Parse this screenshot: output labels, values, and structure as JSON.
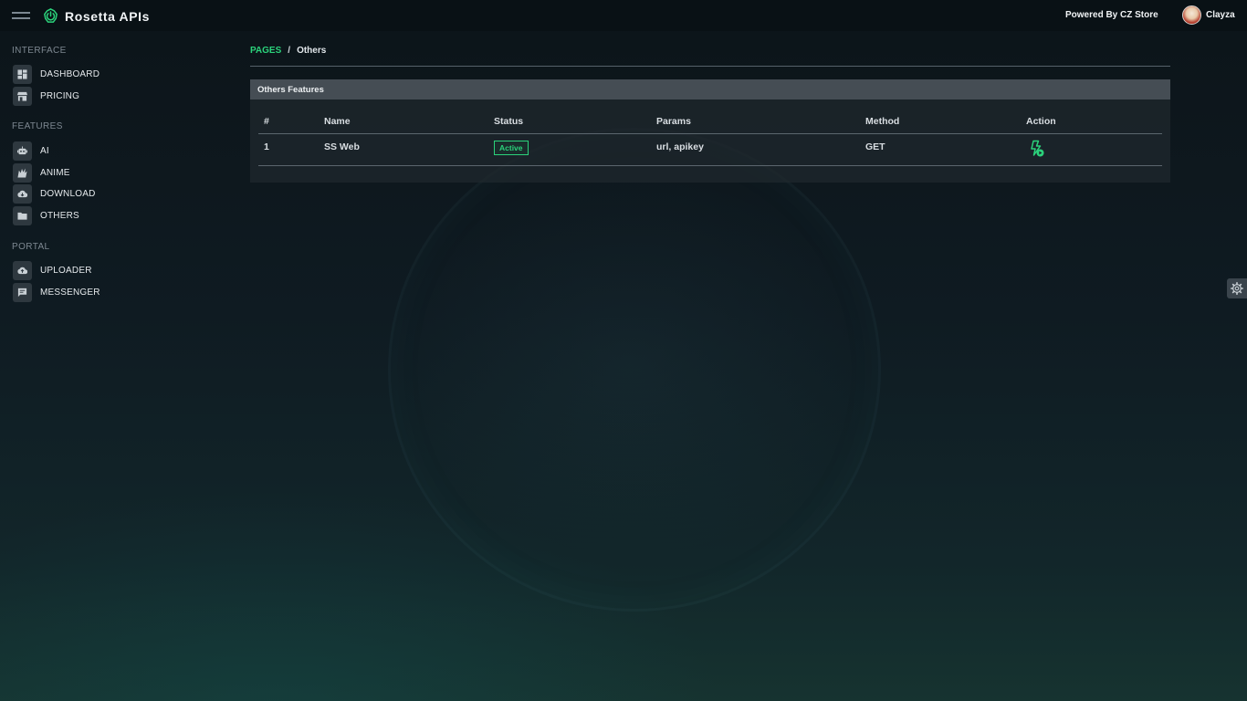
{
  "app": {
    "name": "Rosetta APIs"
  },
  "topbar": {
    "powered_by": "Powered By CZ Store",
    "user_name": "Clayza"
  },
  "sidebar": {
    "sections": [
      {
        "title": "INTERFACE",
        "items": [
          {
            "label": "DASHBOARD",
            "icon": "dashboard-icon"
          },
          {
            "label": "PRICING",
            "icon": "store-icon"
          }
        ]
      },
      {
        "title": "FEATURES",
        "items": [
          {
            "label": "AI",
            "icon": "robot-icon"
          },
          {
            "label": "ANIME",
            "icon": "anime-icon"
          },
          {
            "label": "DOWNLOAD",
            "icon": "cloud-download-icon"
          },
          {
            "label": "OTHERS",
            "icon": "folder-icon"
          }
        ]
      },
      {
        "title": "PORTAL",
        "items": [
          {
            "label": "UPLOADER",
            "icon": "cloud-upload-icon"
          },
          {
            "label": "MESSENGER",
            "icon": "message-icon"
          }
        ]
      }
    ]
  },
  "breadcrumb": {
    "pages": "PAGES",
    "separator": "/",
    "current": "Others"
  },
  "card": {
    "title": "Others Features",
    "columns": [
      "#",
      "Name",
      "Status",
      "Params",
      "Method",
      "Action"
    ],
    "rows": [
      {
        "index": "1",
        "name": "SS Web",
        "status": "Active",
        "params": "url, apikey",
        "method": "GET",
        "action_icon": "run-icon"
      }
    ]
  },
  "colors": {
    "accent": "#2bd27b",
    "background": "#0f1b22",
    "card_header": "#454d54"
  }
}
